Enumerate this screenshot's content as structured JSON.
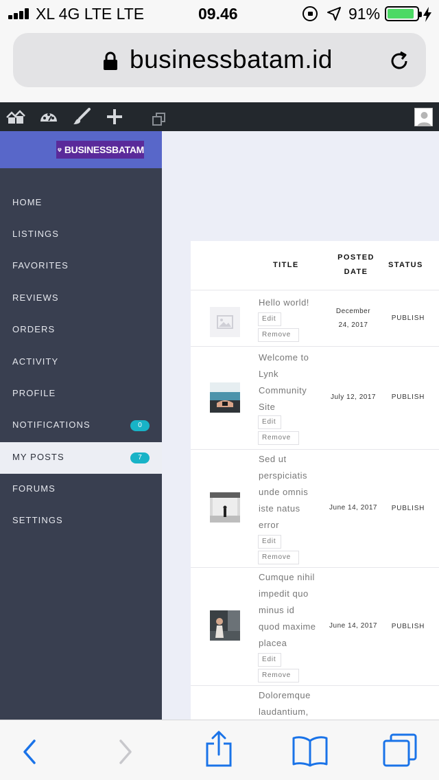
{
  "status_bar": {
    "carrier": "XL 4G LTE   LTE",
    "time": "09.46",
    "battery_percent": "91%",
    "battery_level": 0.91,
    "battery_color": "#4cd964",
    "icons": [
      "signal-icon",
      "rotation-lock-icon",
      "location-arrow-icon",
      "battery-icon",
      "charging-bolt-icon"
    ]
  },
  "browser": {
    "url": "businessbatam.id",
    "icons": [
      "lock-icon",
      "reload-icon"
    ]
  },
  "admin_bar": {
    "icons": [
      "my-sites-icon",
      "dashboard-icon",
      "customize-brush-icon",
      "new-plus-icon",
      "copy-icon",
      "user-avatar-icon"
    ]
  },
  "brand": {
    "logo_text": "BUSINESSBATAM",
    "accent": "#5867c9"
  },
  "sidebar": {
    "items": [
      {
        "label": "HOME"
      },
      {
        "label": "LISTINGS"
      },
      {
        "label": "FAVORITES"
      },
      {
        "label": "REVIEWS"
      },
      {
        "label": "ORDERS"
      },
      {
        "label": "ACTIVITY"
      },
      {
        "label": "PROFILE"
      },
      {
        "label": "NOTIFICATIONS",
        "badge": "0"
      },
      {
        "label": "MY POSTS",
        "badge": "7",
        "active": true
      },
      {
        "label": "FORUMS"
      },
      {
        "label": "SETTINGS"
      }
    ]
  },
  "posts_table": {
    "headers": {
      "title": "TITLE",
      "posted_date_line1": "POSTED",
      "posted_date_line2": "DATE",
      "status": "STATUS"
    },
    "edit_label": "Edit",
    "remove_label": "Remove",
    "rows": [
      {
        "title": "Hello world!",
        "date_line1": "December",
        "date_line2": "24, 2017",
        "status": "PUBLISH",
        "thumb": "image-placeholder-icon"
      },
      {
        "title_lines": [
          "Welcome to",
          "Lynk",
          "Community",
          "Site"
        ],
        "date": "July 12, 2017",
        "status": "PUBLISH",
        "thumb": "pool-photo"
      },
      {
        "title_lines": [
          "Sed ut",
          "perspiciatis",
          "unde omnis",
          "iste natus",
          "error"
        ],
        "date": "June 14, 2017",
        "status": "PUBLISH",
        "thumb": "room-photo"
      },
      {
        "title_lines": [
          "Cumque nihil",
          "impedit quo",
          "minus id",
          "quod maxime",
          "placea"
        ],
        "date": "June 14, 2017",
        "status": "PUBLISH",
        "thumb": "person-photo"
      },
      {
        "title_lines": [
          "Doloremque",
          "laudantium,"
        ]
      }
    ]
  },
  "safari_toolbar": {
    "icons": [
      "back-icon",
      "forward-icon",
      "share-icon",
      "bookmarks-icon",
      "tabs-icon"
    ],
    "tint": "#1a73e8"
  }
}
